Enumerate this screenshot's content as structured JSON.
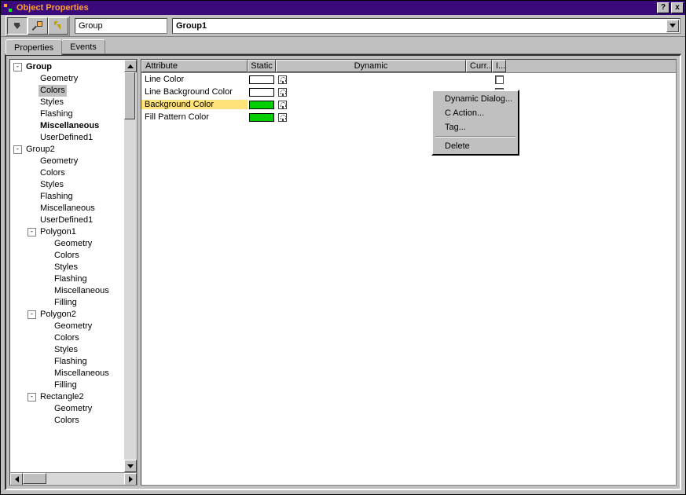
{
  "titlebar": {
    "title": "Object Properties",
    "help_label": "?",
    "close_label": "x"
  },
  "toolbar": {
    "object_type": "Group",
    "object_name": "Group1"
  },
  "tabs": {
    "properties": "Properties",
    "events": "Events"
  },
  "tree": {
    "nodes": [
      {
        "ind": 0,
        "toggle": "-",
        "label": "Group",
        "bold": true
      },
      {
        "ind": 1,
        "label": "Geometry"
      },
      {
        "ind": 1,
        "label": "Colors",
        "selected": true
      },
      {
        "ind": 1,
        "label": "Styles"
      },
      {
        "ind": 1,
        "label": "Flashing"
      },
      {
        "ind": 1,
        "label": "Miscellaneous",
        "bold": true
      },
      {
        "ind": 1,
        "label": "UserDefined1"
      },
      {
        "ind": 0,
        "toggle": "-",
        "label": "Group2"
      },
      {
        "ind": 1,
        "label": "Geometry"
      },
      {
        "ind": 1,
        "label": "Colors"
      },
      {
        "ind": 1,
        "label": "Styles"
      },
      {
        "ind": 1,
        "label": "Flashing"
      },
      {
        "ind": 1,
        "label": "Miscellaneous"
      },
      {
        "ind": 1,
        "label": "UserDefined1"
      },
      {
        "ind": 1,
        "toggle": "-",
        "label": "Polygon1"
      },
      {
        "ind": 2,
        "label": "Geometry"
      },
      {
        "ind": 2,
        "label": "Colors"
      },
      {
        "ind": 2,
        "label": "Styles"
      },
      {
        "ind": 2,
        "label": "Flashing"
      },
      {
        "ind": 2,
        "label": "Miscellaneous"
      },
      {
        "ind": 2,
        "label": "Filling"
      },
      {
        "ind": 1,
        "toggle": "-",
        "label": "Polygon2"
      },
      {
        "ind": 2,
        "label": "Geometry"
      },
      {
        "ind": 2,
        "label": "Colors"
      },
      {
        "ind": 2,
        "label": "Styles"
      },
      {
        "ind": 2,
        "label": "Flashing"
      },
      {
        "ind": 2,
        "label": "Miscellaneous"
      },
      {
        "ind": 2,
        "label": "Filling"
      },
      {
        "ind": 1,
        "toggle": "-",
        "label": "Rectangle2"
      },
      {
        "ind": 2,
        "label": "Geometry"
      },
      {
        "ind": 2,
        "label": "Colors"
      }
    ]
  },
  "grid": {
    "headers": {
      "attribute": "Attribute",
      "static": "Static",
      "dynamic": "Dynamic",
      "curr": "Curr...",
      "ind": "I..."
    },
    "rows": [
      {
        "name": "Line Color",
        "color": "#ffffff",
        "selected": false
      },
      {
        "name": "Line Background Color",
        "color": "#ffffff",
        "selected": false
      },
      {
        "name": "Background Color",
        "color": "#00d000",
        "selected": true
      },
      {
        "name": "Fill Pattern Color",
        "color": "#00d000",
        "selected": false
      }
    ]
  },
  "context_menu": {
    "items": [
      {
        "label": "Dynamic Dialog..."
      },
      {
        "label": "C Action..."
      },
      {
        "label": "Tag..."
      },
      {
        "sep": true
      },
      {
        "label": "Delete"
      }
    ]
  }
}
